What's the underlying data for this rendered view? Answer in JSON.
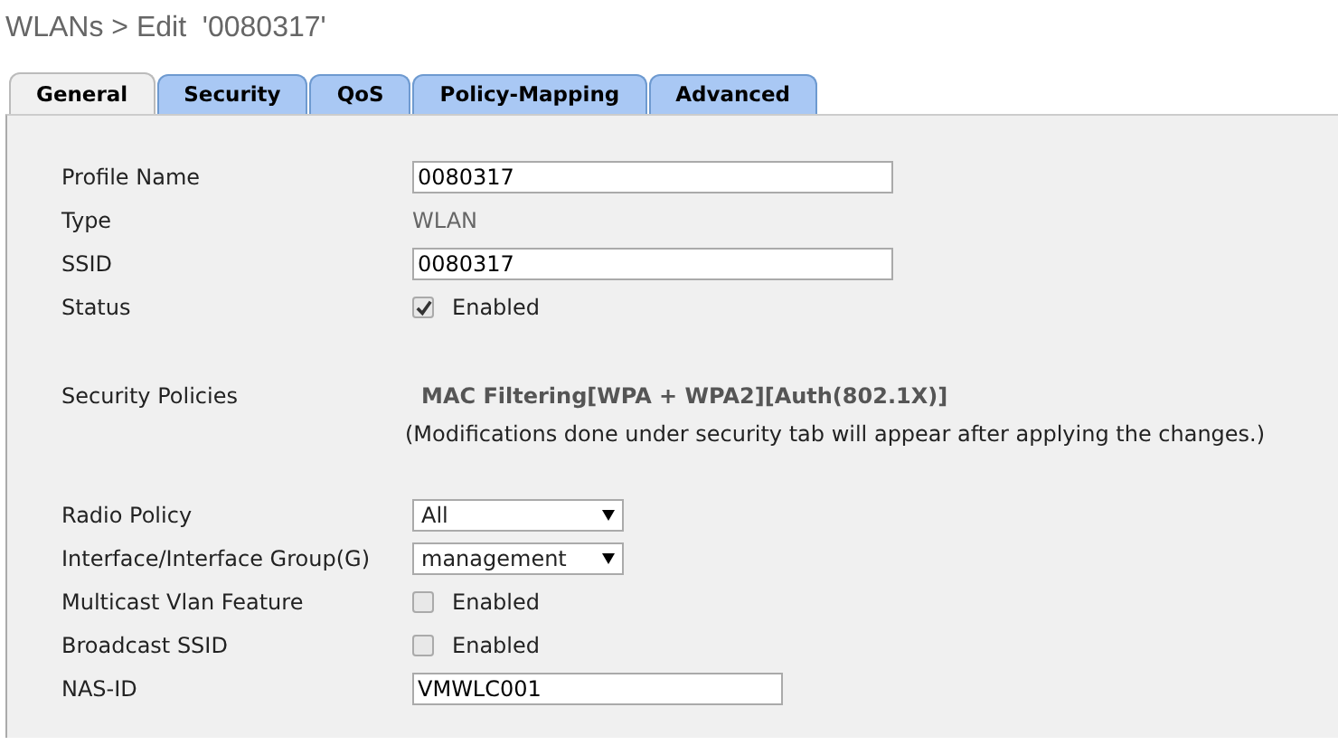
{
  "title": "WLANs > Edit  '0080317'",
  "tabs": [
    {
      "label": "General",
      "selected": true
    },
    {
      "label": "Security",
      "selected": false
    },
    {
      "label": "QoS",
      "selected": false
    },
    {
      "label": "Policy-Mapping",
      "selected": false
    },
    {
      "label": "Advanced",
      "selected": false
    }
  ],
  "sections": [
    [
      {
        "kind": "input",
        "label": "Profile Name",
        "value": "0080317"
      },
      {
        "kind": "static",
        "label": "Type",
        "value": "WLAN"
      },
      {
        "kind": "input",
        "label": "SSID",
        "value": "0080317"
      },
      {
        "kind": "checkbox",
        "label": "Status",
        "checked": true,
        "text": "Enabled"
      }
    ],
    [
      {
        "kind": "policy",
        "label": "Security Policies",
        "value": "MAC Filtering[WPA + WPA2][Auth(802.1X)]",
        "note": "(Modifications done under security tab will appear after applying the changes.)"
      }
    ],
    [
      {
        "kind": "select",
        "label": "Radio Policy",
        "value": "All"
      },
      {
        "kind": "select",
        "label": "Interface/Interface Group(G)",
        "value": "management"
      },
      {
        "kind": "checkbox",
        "label": "Multicast Vlan Feature",
        "checked": false,
        "text": "Enabled"
      },
      {
        "kind": "checkbox",
        "label": "Broadcast SSID",
        "checked": false,
        "text": "Enabled"
      },
      {
        "kind": "input",
        "label": "NAS-ID",
        "value": "VMWLC001"
      }
    ]
  ]
}
